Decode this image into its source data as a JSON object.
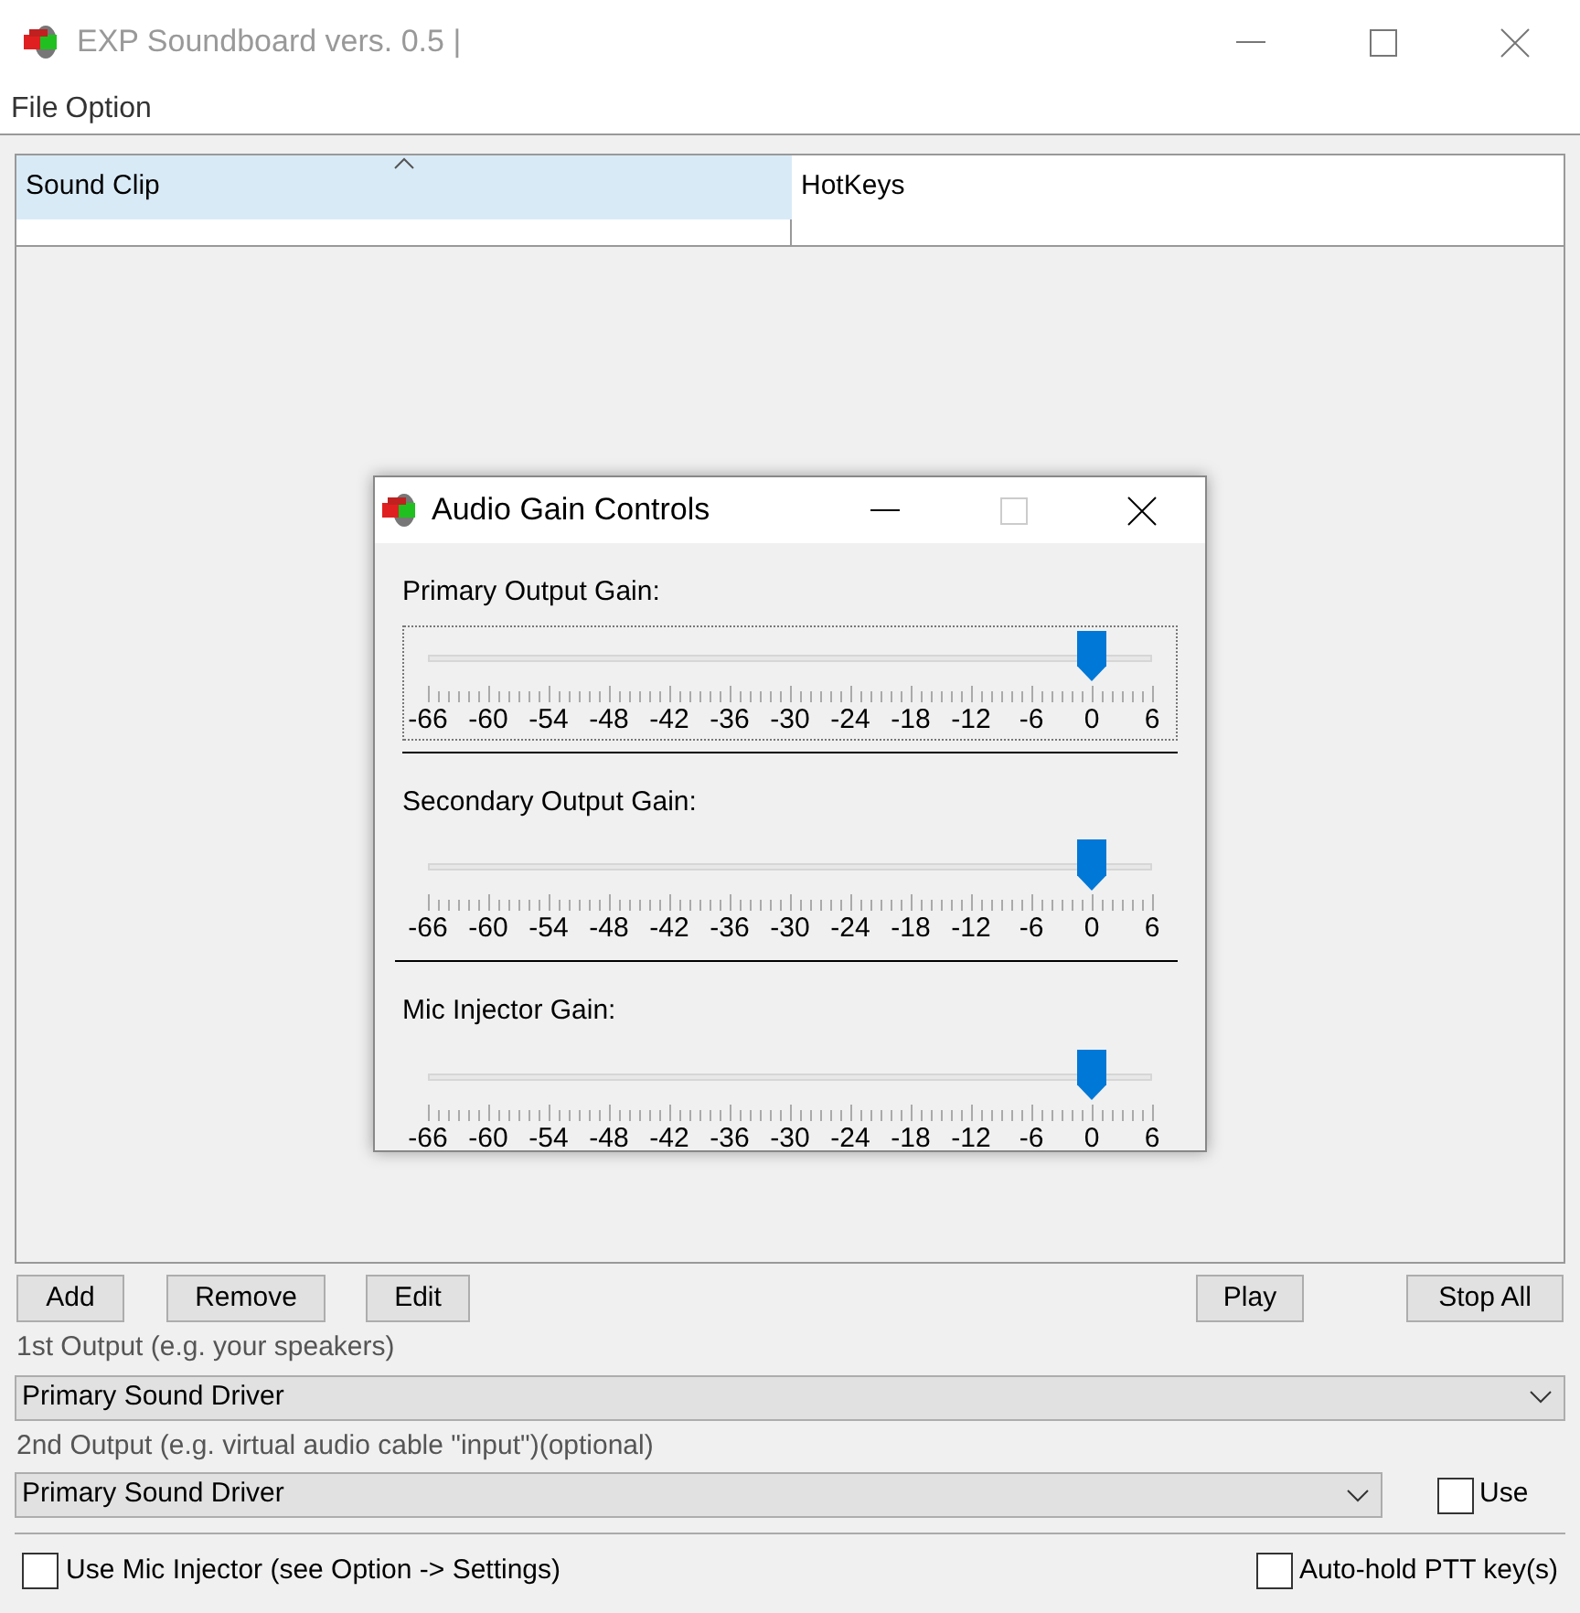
{
  "window": {
    "title": "EXP Soundboard vers. 0.5 |",
    "active": false
  },
  "menu": [
    "File",
    "Option"
  ],
  "table": {
    "columns": [
      {
        "label": "Sound Clip",
        "selected": true,
        "sorted": true
      },
      {
        "label": "HotKeys",
        "selected": false,
        "sorted": false
      }
    ]
  },
  "buttons_left": [
    "Add",
    "Remove",
    "Edit"
  ],
  "buttons_right": [
    "Play",
    "Stop All"
  ],
  "output1": {
    "label": "1st Output (e.g. your speakers)",
    "value": "Primary Sound Driver"
  },
  "output2": {
    "label": "2nd Output (e.g. virtual audio cable \"input\")(optional)",
    "value": "Primary Sound Driver",
    "use": {
      "label": "Use",
      "checked": false
    }
  },
  "options": [
    {
      "label": "Use Mic Injector (see Option -> Settings)",
      "checked": false
    },
    {
      "label": "Auto-hold PTT key(s)",
      "checked": false
    }
  ],
  "dialog": {
    "title": "Audio Gain Controls",
    "sliders": [
      {
        "label": "Primary Output Gain:",
        "level": 0.9167,
        "focused": true,
        "scale": [
          "-66",
          "-60",
          "-54",
          "-48",
          "-42",
          "-36",
          "-30",
          "-24",
          "-18",
          "-12",
          "-6",
          "0",
          "6"
        ]
      },
      {
        "label": "Secondary Output Gain:",
        "level": 0.9167,
        "focused": false,
        "scale": [
          "-66",
          "-60",
          "-54",
          "-48",
          "-42",
          "-36",
          "-30",
          "-24",
          "-18",
          "-12",
          "-6",
          "0",
          "6"
        ]
      },
      {
        "label": "Mic Injector Gain:",
        "level": 0.9167,
        "focused": false,
        "scale": [
          "-66",
          "-60",
          "-54",
          "-48",
          "-42",
          "-36",
          "-30",
          "-24",
          "-18",
          "-12",
          "-6",
          "0",
          "6"
        ]
      }
    ]
  }
}
